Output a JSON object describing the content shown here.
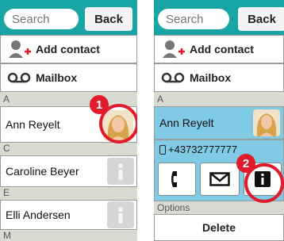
{
  "panels": [
    {
      "search": {
        "placeholder": "Search"
      },
      "back_label": "Back",
      "actions": {
        "add_contact": "Add contact",
        "mailbox": "Mailbox"
      },
      "sections": [
        {
          "letter": "A",
          "contact": "Ann Reyelt"
        },
        {
          "letter": "C",
          "contact": "Caroline Beyer"
        },
        {
          "letter": "E",
          "contact": "Elli Andersen"
        },
        {
          "letter": "M"
        }
      ],
      "step_badge": "1"
    },
    {
      "search": {
        "placeholder": "Search"
      },
      "back_label": "Back",
      "actions": {
        "add_contact": "Add contact",
        "mailbox": "Mailbox"
      },
      "sections": [
        {
          "letter": "A",
          "contact": "Ann Reyelt"
        }
      ],
      "phone_number": "+43732777777",
      "step_badge": "2",
      "options_label": "Options",
      "delete_label": "Delete"
    }
  ],
  "colors": {
    "header": "#1aa5a5",
    "selected": "#7fcbe6",
    "badge": "#e01c2c",
    "background": "#d9dbd3"
  },
  "icons": [
    "add-contact-icon",
    "voicemail-icon",
    "avatar-photo",
    "avatar-placeholder-icon",
    "phone-icon",
    "mail-icon",
    "info-icon"
  ]
}
